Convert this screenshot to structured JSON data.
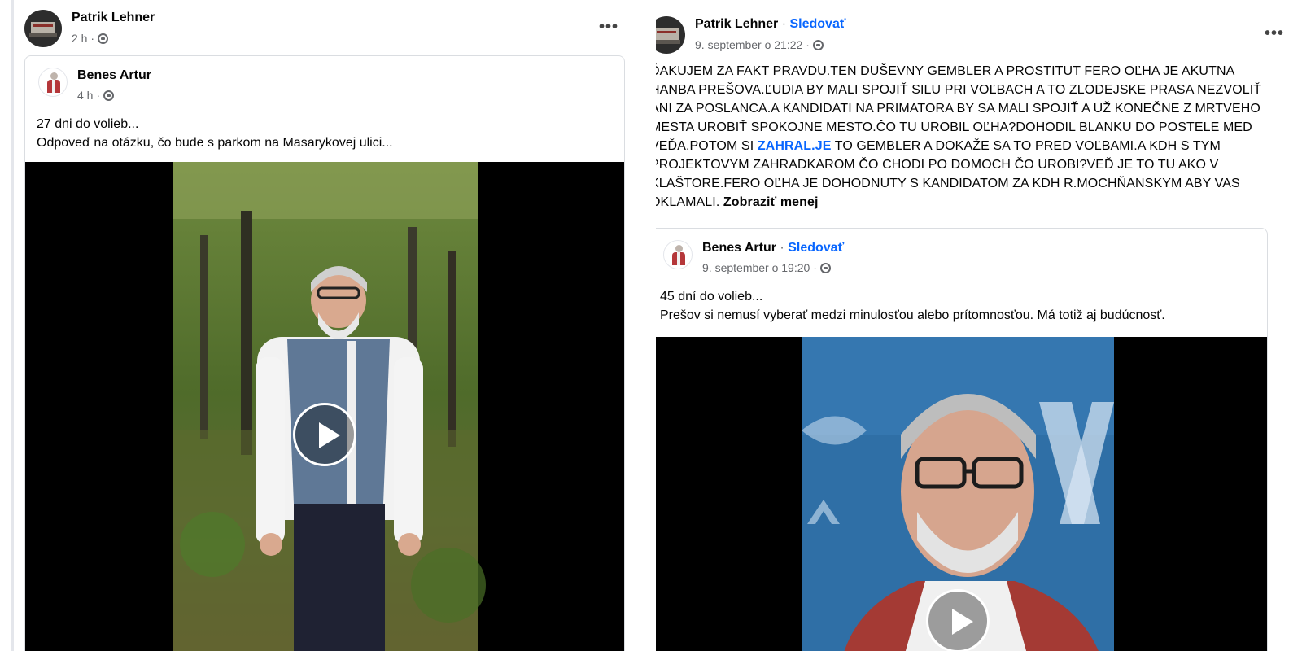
{
  "left_post": {
    "author": "Patrik Lehner",
    "time": "2 h",
    "more_label": "•••",
    "shared": {
      "author": "Benes Artur",
      "time": "4 h",
      "text_line1": "27 dni do volieb...",
      "text_line2": "Odpoveď na otázku, čo bude s parkom na Masarykovej ulici..."
    }
  },
  "right_post": {
    "author": "Patrik Lehner",
    "separator": " · ",
    "follow_label": "Sledovať",
    "time": "9. september o 21:22",
    "more_label": "•••",
    "text_part1": "ĎAKUJEM ZA FAKT PRAVDU.TEN DUŠEVNY GEMBLER A PROSTITUT FERO OĽHA JE AKUTNA HANBA PREŠOVA.ĽUDIA BY MALI SPOJIŤ SILU PRI VOĽBACH A TO ZLODEJSKE PRASA NEZVOLIŤ ANI ZA POSLANCA.A KANDIDATI NA PRIMATORA BY SA MALI SPOJIŤ A UŽ KONEČNE Z MRTVEHO MESTA UROBIŤ SPOKOJNE MESTO.ČO TU UROBIL OĽHA?DOHODIL BLANKU DO POSTELE MED VEĎA,POTOM SI ",
    "text_link": "ZAHRAL.JE",
    "text_part2": " TO GEMBLER A DOKAŽE SA TO PRED VOĽBAMI.A KDH S TYM PROJEKTOVYM ZAHRADKAROM ČO CHODI PO DOMOCH ČO UROBI?VEĎ JE TO TU AKO V KLAŠTORE.FERO OĽHA JE DOHODNUTY S KANDIDATOM ZA KDH R.MOCHŇANSKYM ABY VAS OKLAMALI. ",
    "show_less_label": "Zobraziť menej",
    "shared": {
      "author": "Benes Artur",
      "separator": " · ",
      "follow_label": "Sledovať",
      "time": "9. september o 19:20",
      "text_line1": "45 dní do volieb...",
      "text_line2": "Prešov si nemusí vyberať medzi minulosťou alebo prítomnosťou. Má totiž aj budúcnosť."
    }
  },
  "colors": {
    "link_blue": "#0866ff",
    "meta_gray": "#65676b",
    "video_bg": "#000000"
  },
  "icons": [
    "globe-icon",
    "more-options-icon",
    "play-icon"
  ]
}
